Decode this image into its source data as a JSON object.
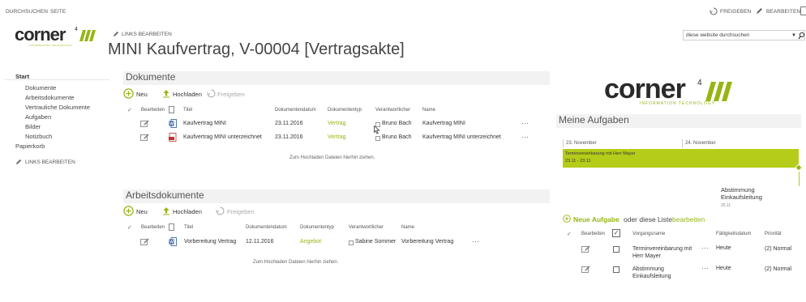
{
  "topbar": {
    "browse": "DURCHSUCHEN",
    "page": "SEITE",
    "share": "FREIGEBEN",
    "edit": "BEARBEITEN"
  },
  "header": {
    "logo_word": "corner",
    "logo_sup": "4",
    "logo_tag": "INFORMATION TECHNOLOGY",
    "edit_links": "LINKS BEARBEITEN",
    "title": "MINI Kaufvertrag, V-00004 [Vertragsakte]",
    "search_placeholder": "diese website durchsuchen"
  },
  "nav": {
    "start": "Start",
    "items": [
      "Dokumente",
      "Arbeitsdokumente",
      "Vertrauliche Dokumente",
      "Aufgaben",
      "Bilder",
      "Notizbuch"
    ],
    "trash": "Papierkorb",
    "edit_links": "LINKS BEARBEITEN"
  },
  "docs": {
    "title": "Dokumente",
    "new": "Neu",
    "upload": "Hochladen",
    "share": "Freigeben",
    "columns": {
      "edit": "Bearbeiten",
      "title": "Titel",
      "date": "Dokumentendatum",
      "type": "Dokumententyp",
      "owner": "Verantwortlicher",
      "name": "Name"
    },
    "rows": [
      {
        "title": "Kaufvertrag MINI",
        "date": "23.11.2016",
        "type": "Vertrag",
        "owner": "Bruno Bach",
        "name": "Kaufvertrag MINI",
        "more": "···"
      },
      {
        "title": "Kaufvertrag MINI unterzeichnet",
        "date": "23.11.2016",
        "type": "Vertrag",
        "owner": "Bruno Bach",
        "name": "Kaufvertrag MINI unterzeichnet",
        "more": "···"
      }
    ],
    "drop": "Zum Hochladen Dateien hierhin ziehen."
  },
  "work": {
    "title": "Arbeitsdokumente",
    "new": "Neu",
    "upload": "Hochladen",
    "share": "Freigeben",
    "columns": {
      "edit": "Bearbeiten",
      "title": "Titel",
      "date": "Dokumentendatum",
      "type": "Dokumententyp",
      "owner": "Verantwortlicher",
      "name": "Name"
    },
    "rows": [
      {
        "title": "Vorbereitung Vertrag",
        "date": "12.11.2016",
        "type": "Angebot",
        "owner": "Sabine Sommer",
        "name": "Vorbereitung Vertrag",
        "more": "···"
      }
    ],
    "drop": "Zum Hochladen Dateien hierhin ziehen."
  },
  "tasks": {
    "title": "Meine Aufgaben",
    "timeline": {
      "date1": "23. November",
      "date2": "24. November",
      "bar_title": "Terminvereinbarung mit Herr Mayer",
      "bar_dates": "23.11 - 23.11",
      "below_title": "Abstimmung Einkaufsleitung",
      "below_date": "25.11"
    },
    "new_task": "Neue Aufgabe",
    "or_text": "oder diese Liste",
    "edit_list": "bearbeiten",
    "columns": {
      "edit": "Bearbeiten",
      "name": "Vorgangsname",
      "due": "Fälligkeitsdatum",
      "priority": "Priorität"
    },
    "rows": [
      {
        "name": "Terminvereinbarung mit Herr Mayer",
        "more": "···",
        "due": "Heute",
        "priority": "(2) Normal"
      },
      {
        "name": "Abstimmung Einkaufsleitung",
        "more": "···",
        "due": "Heute",
        "priority": "(2) Normal"
      }
    ]
  },
  "colors": {
    "accent": "#95b513",
    "timeline_bar": "#b5cc18"
  }
}
